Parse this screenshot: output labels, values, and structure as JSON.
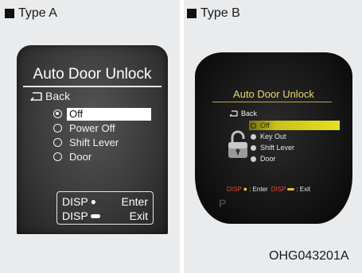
{
  "panel_a": {
    "header": "Type A",
    "title": "Auto Door Unlock",
    "back": "Back",
    "options": [
      {
        "label": "Off",
        "selected": true
      },
      {
        "label": "Power Off",
        "selected": false
      },
      {
        "label": "Shift Lever",
        "selected": false
      },
      {
        "label": "Door",
        "selected": false
      }
    ],
    "keys": {
      "enter_key": "DISP",
      "enter_label": "Enter",
      "exit_key": "DISP",
      "exit_label": "Exit"
    }
  },
  "panel_b": {
    "header": "Type B",
    "title": "Auto Door Unlock",
    "back": "Back",
    "options": [
      {
        "label": "Off",
        "selected": true
      },
      {
        "label": "Key Out",
        "selected": false
      },
      {
        "label": "Shift Lever",
        "selected": false
      },
      {
        "label": "Door",
        "selected": false
      }
    ],
    "hint": {
      "enter_key": "DISP",
      "enter_label": ": Enter",
      "exit_key": "DISP",
      "exit_label": ": Exit"
    },
    "gear": "P",
    "icons": [
      "padlock-icon",
      "back-arrow-icon"
    ]
  },
  "figure_code": "OHG043201A",
  "colors": {
    "panel_bg": "#e9ebed",
    "b_title": "#e8d96a",
    "b_highlight": "#e6df22",
    "b_hint_key": "#d84a3a"
  }
}
